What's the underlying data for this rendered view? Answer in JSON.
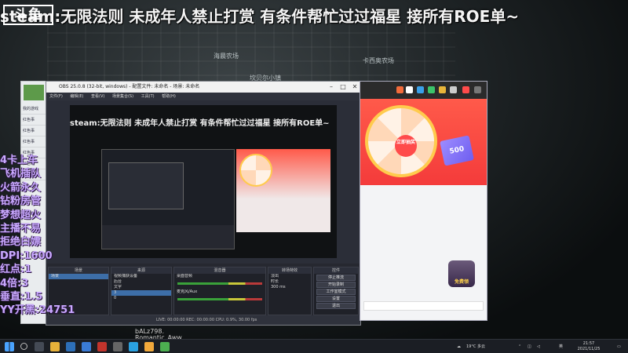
{
  "banner": {
    "logo": "斗鱼",
    "ticker": "steam:无限法则 未成年人禁止打赏 有条件帮忙过过福星 接所有ROE单~"
  },
  "map": {
    "labels": [
      "海晨农场",
      "卡西奥农场",
      "坎贝尔小镇"
    ]
  },
  "side_info": [
    "4卡上车",
    "飞机插队",
    "火箭永久",
    "钻粉房管",
    "梦想超火",
    "主播不易",
    "拒绝白嫖",
    "DPI:1600",
    "红点:1",
    "4倍:3",
    "垂直:1.5",
    "YY开黑:24751"
  ],
  "app_side": {
    "items": [
      "我的游戏",
      "红色事",
      "红色事",
      "红色事",
      "红色事",
      "红色事",
      "红色事"
    ]
  },
  "obs": {
    "title": "OBS 25.0.8 (32-bit, windows) - 配置文件: 未命名 - 场景: 未命名",
    "menu": [
      "文件(F)",
      "编辑(E)",
      "查看(V)",
      "场景集合(S)",
      "工具(T)",
      "帮助(H)"
    ],
    "preview_ticker": "steam:无限法则 未成年人禁止打赏 有条件帮忙过过福星 接所有ROE单~",
    "docks": {
      "scenes": {
        "title": "场景",
        "items": [
          "场景"
        ]
      },
      "sources": {
        "title": "来源",
        "items": [
          "视频捕获设备",
          "后台",
          "文字",
          "3",
          "0"
        ]
      },
      "mixer": {
        "title": "混音器",
        "tracks": [
          "桌面音频",
          "麦克风/Aux"
        ]
      },
      "transitions": {
        "title": "转场特效",
        "items": [
          "淡出",
          "时长",
          "300 ms"
        ]
      },
      "controls": {
        "title": "控件",
        "buttons": [
          "停止推流",
          "开始录制",
          "工作室模式",
          "设置",
          "退出"
        ]
      }
    },
    "status": "LIVE: 00:00:00    REC: 00:00:00    CPU: 0.9%, 30.00 fps"
  },
  "browser": {
    "wheel_center": "立即抽奖",
    "card_value": "500",
    "button": "免费领"
  },
  "desktop_text": [
    "bALz798.",
    "Romantic_Aww"
  ],
  "taskbar": {
    "weather": "19°C 多云",
    "lang": "英",
    "time": "21:57",
    "date": "2021/11/25"
  }
}
